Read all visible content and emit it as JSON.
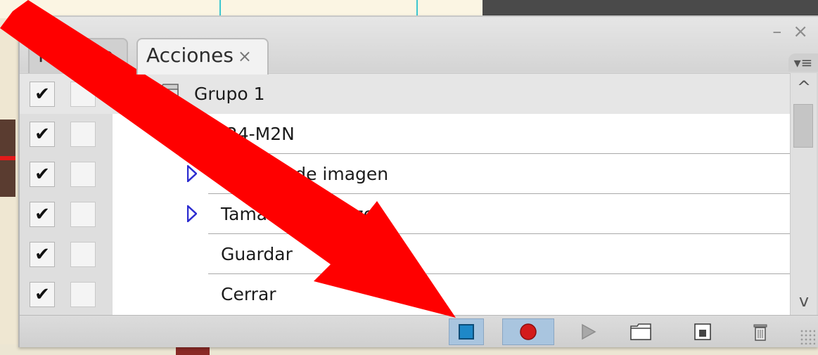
{
  "tabs": [
    {
      "label": "Historia",
      "active": false
    },
    {
      "label": "Acciones",
      "active": true,
      "close_glyph": "×"
    }
  ],
  "window_controls": {
    "minimize": "–",
    "close": "×"
  },
  "panel_menu_glyph": "▾≡",
  "actions": [
    {
      "label": "Grupo 1",
      "type": "group",
      "checked": true,
      "check_glyph": "✔"
    },
    {
      "label": "1024-M2N",
      "type": "action",
      "checked": true,
      "check_glyph": "✔"
    },
    {
      "label": "Tamaño de imagen",
      "type": "step",
      "checked": true,
      "check_glyph": "✔"
    },
    {
      "label": "Tamaño de lienzo",
      "type": "step",
      "checked": true,
      "check_glyph": "✔"
    },
    {
      "label": "Guardar",
      "type": "step",
      "checked": true,
      "check_glyph": "✔"
    },
    {
      "label": "Cerrar",
      "type": "step",
      "checked": true,
      "check_glyph": "✔"
    }
  ],
  "scrollbar": {
    "up_glyph": "^",
    "down_glyph": "v"
  },
  "toolbar": [
    {
      "name": "stop-recording-button",
      "icon": "stop-icon",
      "active": true
    },
    {
      "name": "record-button",
      "icon": "record-icon",
      "active": true
    },
    {
      "name": "play-button",
      "icon": "play-icon",
      "active": false
    },
    {
      "name": "new-set-button",
      "icon": "folder-icon",
      "active": false
    },
    {
      "name": "new-action-button",
      "icon": "new-page-icon",
      "active": false
    },
    {
      "name": "delete-button",
      "icon": "trash-icon",
      "active": false
    }
  ],
  "colors": {
    "accent_arrow": "#ff0000",
    "stop_icon": "#1e88c8",
    "record_icon": "#d31b1b",
    "active_button": "#a9c5df",
    "triangle_fill": "#2c2cd0"
  }
}
